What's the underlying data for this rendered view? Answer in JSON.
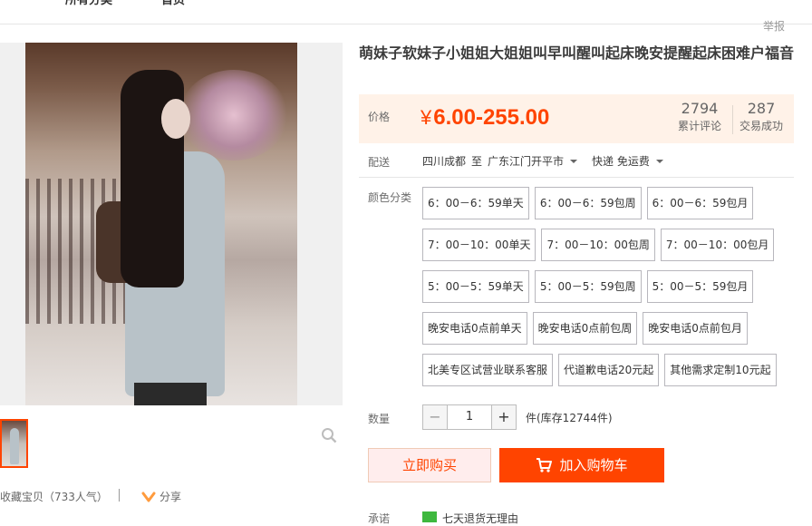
{
  "nav": {
    "all_categories": "所有分类",
    "home": "首页",
    "report": "举报"
  },
  "product": {
    "title": "萌妹子软妹子小姐姐大姐姐叫早叫醒叫起床晚安提醒起床困难户福音",
    "price_label": "价格",
    "currency": "¥",
    "price": "6.00-255.00",
    "reviews_count": "2794",
    "reviews_label": "累计评论",
    "sales_count": "287",
    "sales_label": "交易成功"
  },
  "shipping": {
    "label": "配送",
    "from": "四川成都",
    "to_word": "至",
    "to": "广东江门开平市",
    "method": "快递 免运费"
  },
  "sku": {
    "label": "颜色分类",
    "rows": [
      [
        "6：00－6：59单天",
        "6：00－6：59包周",
        "6：00－6：59包月"
      ],
      [
        "7：00－10：00单天",
        "7：00－10：00包周",
        "7：00－10：00包月"
      ],
      [
        "5：00－5：59单天",
        "5：00－5：59包周",
        "5：00－5：59包月"
      ],
      [
        "晚安电话0点前单天",
        "晚安电话0点前包周",
        "晚安电话0点前包月"
      ],
      [
        "北美专区试营业联系客服",
        "代道歉电话20元起",
        "其他需求定制10元起"
      ]
    ]
  },
  "quantity": {
    "label": "数量",
    "minus": "−",
    "value": "1",
    "plus": "+",
    "stock": "件(库存12744件)"
  },
  "actions": {
    "buy_now": "立即购买",
    "add_to_cart": "加入购物车"
  },
  "gallery": {
    "favorite": "收藏宝贝（733人气）",
    "share": "分享"
  },
  "promise": {
    "label": "承诺",
    "text": "七天退货无理由"
  },
  "colors": {
    "accent": "#ff4400",
    "price_bg": "#fff2e8",
    "buy_bg": "#ffeded"
  }
}
